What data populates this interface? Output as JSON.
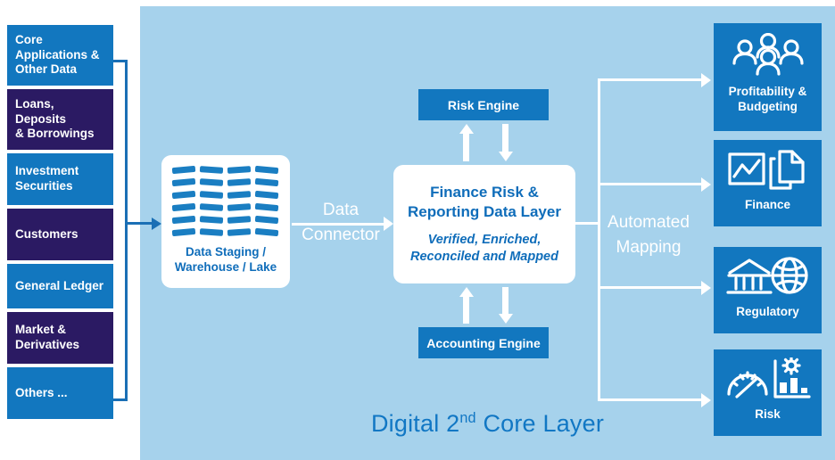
{
  "colors": {
    "panel_bg": "#a6d2ec",
    "blue": "#1277bf",
    "navy": "#2b1a63",
    "deep_blue_text": "#0f6dba",
    "title_blue": "#1177c4",
    "white": "#ffffff",
    "bracket_blue": "#1a6fb5"
  },
  "sources": {
    "items": [
      {
        "label": "Core\nApplications &\nOther Data",
        "tone": "blue",
        "bold": true
      },
      {
        "label": "Loans,\nDeposits\n& Borrowings",
        "tone": "navy",
        "bold": false
      },
      {
        "label": "Investment\nSecurities",
        "tone": "blue",
        "bold": false
      },
      {
        "label": "Customers",
        "tone": "navy",
        "bold": false
      },
      {
        "label": "General Ledger",
        "tone": "blue",
        "bold": false
      },
      {
        "label": "Market &\nDerivatives",
        "tone": "navy",
        "bold": false
      },
      {
        "label": "Others ...",
        "tone": "blue",
        "bold": false
      }
    ]
  },
  "lake": {
    "line1": "Data Staging /",
    "line2": "Warehouse / Lake",
    "icon": "data-lake-grid-icon"
  },
  "connector": {
    "line1": "Data",
    "line2": "Connector",
    "arrow_icon": "arrow-right-icon"
  },
  "engines": {
    "risk": "Risk Engine",
    "accounting": "Accounting Engine",
    "up_arrow_icon": "arrow-up-icon",
    "down_arrow_icon": "arrow-down-icon"
  },
  "core": {
    "title_line1": "Finance Risk &",
    "title_line2": "Reporting Data Layer",
    "sub_line1": "Verified, Enriched,",
    "sub_line2": "Reconciled and Mapped"
  },
  "mapping": {
    "line1": "Automated",
    "line2": "Mapping"
  },
  "outputs": {
    "items": [
      {
        "label": "Profitability &\nBudgeting",
        "icon": "people-group-icon"
      },
      {
        "label": "Finance",
        "icon": "chart-and-documents-icon"
      },
      {
        "label": "Regulatory",
        "icon": "bank-and-globe-icon"
      },
      {
        "label": "Risk",
        "icon": "gauge-and-bar-chart-icon"
      }
    ]
  },
  "footer": {
    "title_before": "Digital 2",
    "title_sup": "nd",
    "title_after": " Core Layer"
  }
}
